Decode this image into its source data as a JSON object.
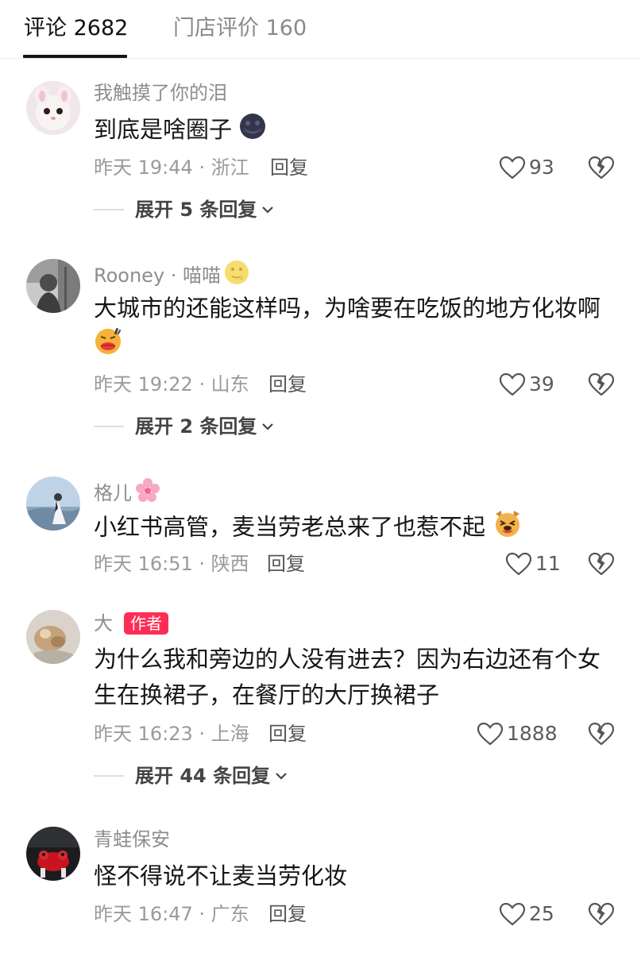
{
  "tabs": [
    {
      "label": "评论 2682"
    },
    {
      "label": "门店评价 160"
    }
  ],
  "comments": [
    {
      "username": "我触摸了你的泪",
      "text": "到底是啥圈子",
      "meta": "昨天 19:44 · 浙江",
      "reply_label": "回复",
      "likes": "93",
      "expand": "展开 5 条回复",
      "emoji": "new-moon-face-emoji"
    },
    {
      "username": "Rooney · 喵喵",
      "text": "大城市的还能这样吗，为啥要在吃饭的地方化妆啊",
      "meta": "昨天 19:22 · 山东",
      "reply_label": "回复",
      "likes": "39",
      "expand": "展开 2 条回复",
      "emoji": "face-with-lipstick-emoji"
    },
    {
      "username": "格儿",
      "text": "小红书高管，麦当劳老总来了也惹不起",
      "meta": "昨天 16:51 · 陕西",
      "reply_label": "回复",
      "likes": "11",
      "emoji": "laughing-dog-emoji"
    },
    {
      "username": "大",
      "badge": "作者",
      "text": "为什么我和旁边的人没有进去？因为右边还有个女生在换裙子，在餐厅的大厅换裙子",
      "meta": "昨天 16:23 · 上海",
      "reply_label": "回复",
      "likes": "1888",
      "expand": "展开 44 条回复"
    },
    {
      "username": "青蛙保安",
      "text": "怪不得说不让麦当劳化妆",
      "meta": "昨天 16:47 · 广东",
      "reply_label": "回复",
      "likes": "25"
    }
  ],
  "icons": {
    "like": "heart-outline-icon",
    "dislike": "broken-heart-icon",
    "expand_arrow": "chevron-down-icon"
  },
  "colors": {
    "accent_badge": "#ff2d55",
    "secondary_text": "#8e8e8e"
  }
}
